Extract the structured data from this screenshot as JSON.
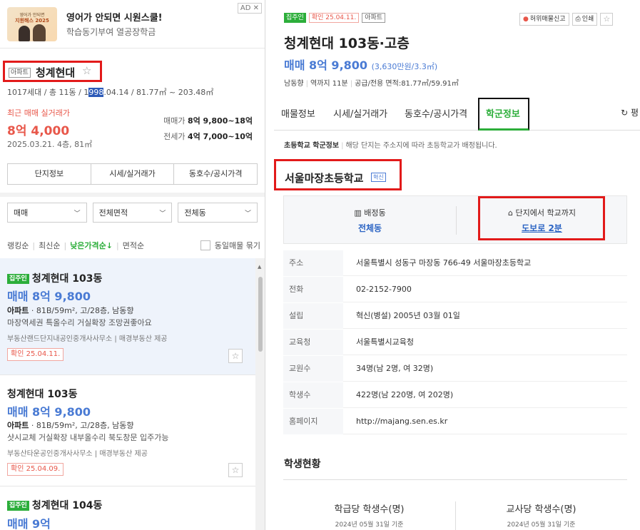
{
  "ad": {
    "thumb_line1": "영어가 안되면",
    "thumb_line2": "지원해스 2025",
    "title": "영어가 안되면 시원스쿨!",
    "subtitle": "학습동기부여 열공장학금",
    "badge": "AD ✕"
  },
  "complex": {
    "type_tag": "아파트",
    "name": "청계현대",
    "info_before": "1017세대 / 총 11동 / 1",
    "info_highlight": "998",
    "info_after": ".04.14 / 81.77㎡ ~ 203.48㎡",
    "recent_label": "최근 매매 실거래가",
    "recent_price": "8억 4,000",
    "recent_date": "2025.03.21. 4층, 81㎡",
    "sale_label": "매매가",
    "sale_range": "8억 9,800~18억",
    "jeonse_label": "전세가",
    "jeonse_range": "4억 7,000~10억",
    "tabs": [
      "단지정보",
      "시세/실거래가",
      "동호수/공시가격"
    ]
  },
  "filters": {
    "deal": "매매",
    "area": "전체면적",
    "dong": "전체동"
  },
  "sort": {
    "ranking": "랭킹순",
    "newest": "최신순",
    "low_price": "낮은가격순↓",
    "area": "면적순",
    "group_label": "동일매물 묶기"
  },
  "listings": [
    {
      "owner_badge": "집주인",
      "title": "청계현대 103동",
      "price": "매매 8억 9,800",
      "spec_type": "아파트",
      "spec": " · 81B/59m², 고/28층, 남동향",
      "desc": "마장역세권 특올수리 거실확장 조망권좋아요",
      "agent": "부동산랜드단지내공인중개사사무소 | 매경부동산 제공",
      "confirm": "확인 25.04.11."
    },
    {
      "owner_badge": "",
      "title": "청계현대 103동",
      "price": "매매 8억 9,800",
      "spec_type": "아파트",
      "spec": " · 81B/59m², 고/28층, 남동향",
      "desc": "샷시교체 거실확장 내부올수리 북도창문 입주가능",
      "agent": "부동산타운공인중개사사무소 | 매경부동산 제공",
      "confirm": "확인 25.04.09."
    },
    {
      "owner_badge": "집주인",
      "title": "청계현대 104동",
      "price": "매매 9억"
    }
  ],
  "detail": {
    "owner_badge": "집주인",
    "confirm": "확인 25.04.11.",
    "type_tag": "아파트",
    "report_label": "허위매물신고",
    "print_label": "인쇄",
    "title": "청계현대 103동·고층",
    "price": "매매 8억 9,800",
    "price_unit": "(3,630만원/3.3㎡)",
    "direction": "남동향",
    "station": "역까지 11분",
    "area": "공급/전용 면적:81.77㎡/59.91㎡",
    "tabs": [
      "매물정보",
      "시세/실거래가",
      "동호수/공시가격",
      "학군정보"
    ],
    "refresh_label": "평",
    "note_bold": "초등학교 학군정보",
    "note_text": "해당 단지는 주소지에 따라 초등학교가 배정됩니다."
  },
  "school": {
    "name": "서울마장초등학교",
    "innov_tag": "혁신",
    "assign_label": "배정동",
    "assign_value": "전체동",
    "distance_label": "단지에서 학교까지",
    "distance_value": "도보로 2분",
    "rows": [
      {
        "k": "주소",
        "v": "서울특별시 성동구 마장동 766-49 서울마장초등학교"
      },
      {
        "k": "전화",
        "v": "02-2152-7900"
      },
      {
        "k": "설립",
        "v": "혁신(병설) 2005년 03월 01일"
      },
      {
        "k": "교육청",
        "v": "서울특별시교육청"
      },
      {
        "k": "교원수",
        "v": "34명(남 2명, 여 32명)"
      },
      {
        "k": "학생수",
        "v": "422명(남 220명, 여 202명)"
      },
      {
        "k": "홈페이지",
        "v": "http://majang.sen.es.kr"
      }
    ],
    "stats_title": "학생현황",
    "stats": [
      {
        "title": "학급당 학생수(명)",
        "date": "2024년 05월 31일 기준"
      },
      {
        "title": "교사당 학생수(명)",
        "date": "2024년 05월 31일 기준"
      }
    ]
  }
}
